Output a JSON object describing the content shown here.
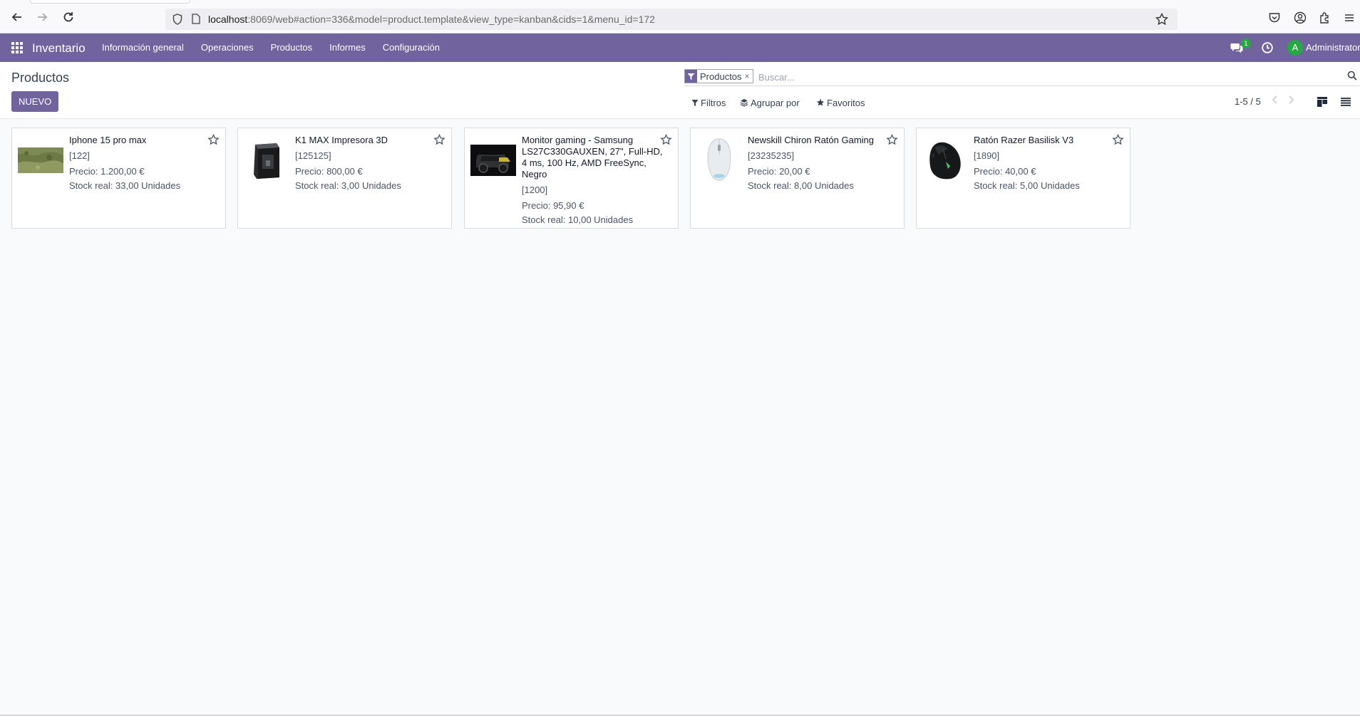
{
  "browser": {
    "url_host": "localhost",
    "url_rest": ":8069/web#action=336&model=product.template&view_type=kanban&cids=1&menu_id=172"
  },
  "app": {
    "brand": "Inventario",
    "menu": [
      "Información general",
      "Operaciones",
      "Productos",
      "Informes",
      "Configuración"
    ],
    "chat_badge": "1",
    "avatar_letter": "A",
    "user_name": "Administrator"
  },
  "control_panel": {
    "title": "Productos",
    "new_button": "NUEVO",
    "facet_label": "Productos",
    "facet_remove": "×",
    "search_placeholder": "Buscar...",
    "filters_label": "Filtros",
    "group_by_label": "Agrupar por",
    "favorites_label": "Favoritos",
    "pager": "1-5 / 5"
  },
  "products": [
    {
      "name": "Iphone 15 pro max",
      "ref": "[122]",
      "price": "Precio: 1.200,00 €",
      "stock": "Stock real: 33,00 Unidades",
      "image": "landscape-photo"
    },
    {
      "name": "K1 MAX Impresora 3D",
      "ref": "[125125]",
      "price": "Precio: 800,00 €",
      "stock": "Stock real: 3,00 Unidades",
      "image": "3d-printer"
    },
    {
      "name": "Monitor gaming - Samsung LS27C330GAUXEN, 27\", Full-HD, 4 ms, 100 Hz, AMD FreeSync, Negro",
      "ref": "[1200]",
      "price": "Precio: 95,90 €",
      "stock": "Stock real: 10,00 Unidades",
      "image": "vehicle-photo"
    },
    {
      "name": "Newskill Chiron Ratón Gaming",
      "ref": "[23235235]",
      "price": "Precio: 20,00 €",
      "stock": "Stock real: 8,00 Unidades",
      "image": "white-mouse"
    },
    {
      "name": "Ratón Razer Basilisk V3",
      "ref": "[1890]",
      "price": "Precio: 40,00 €",
      "stock": "Stock real: 5,00 Unidades",
      "image": "black-mouse"
    }
  ],
  "colors": {
    "brand_purple": "#71639e",
    "badge_green": "#28a745"
  }
}
